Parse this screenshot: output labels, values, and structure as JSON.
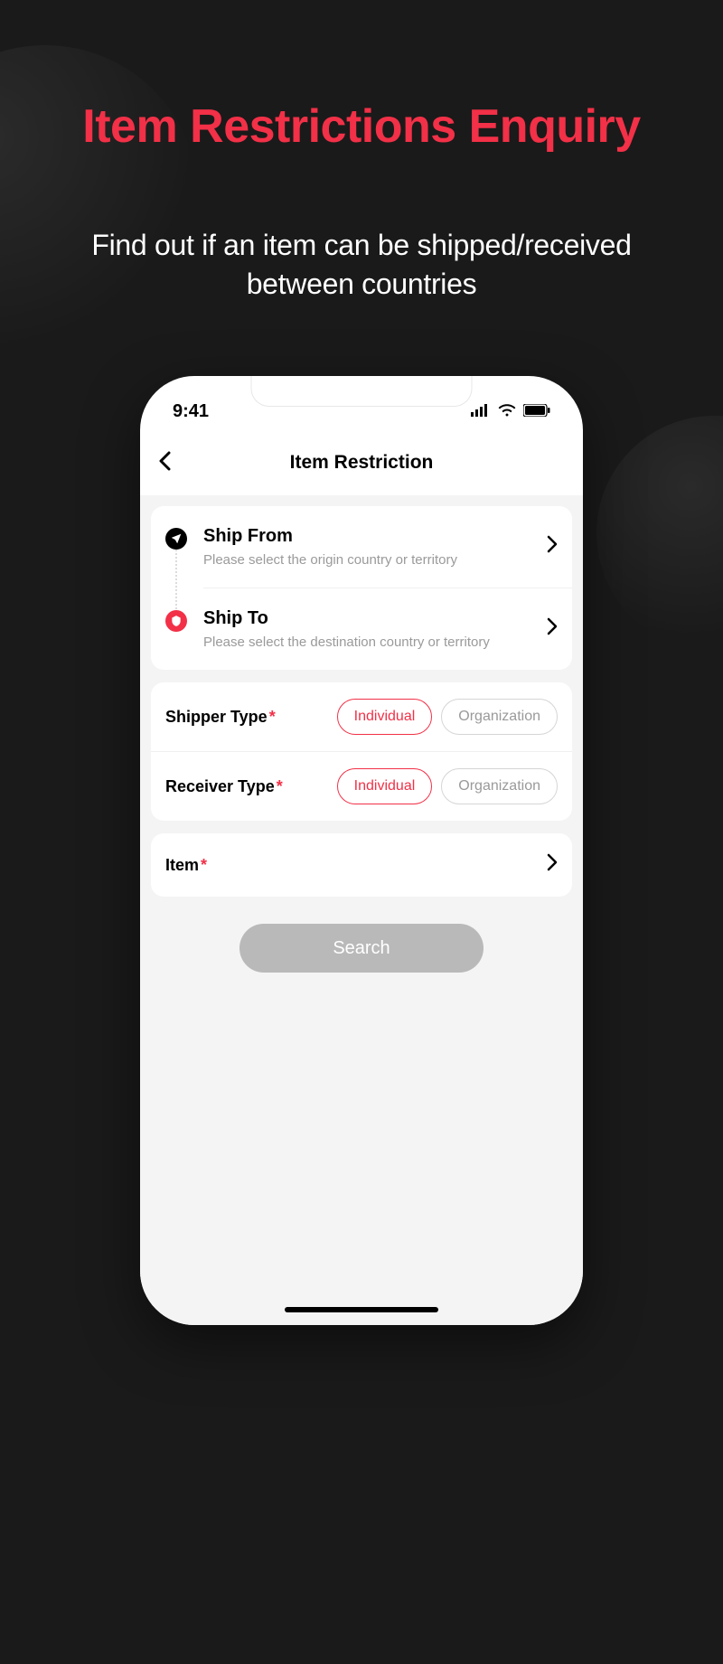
{
  "hero": {
    "title": "Item Restrictions Enquiry",
    "subtitle": "Find out if an item can be shipped/received between countries"
  },
  "status": {
    "time": "9:41"
  },
  "nav": {
    "title": "Item Restriction"
  },
  "ship_from": {
    "label": "Ship From",
    "hint": "Please select the origin country or territory"
  },
  "ship_to": {
    "label": "Ship To",
    "hint": "Please select the destination country or territory"
  },
  "shipper_type": {
    "label": "Shipper Type",
    "option_individual": "Individual",
    "option_organization": "Organization"
  },
  "receiver_type": {
    "label": "Receiver Type",
    "option_individual": "Individual",
    "option_organization": "Organization"
  },
  "item": {
    "label": "Item"
  },
  "actions": {
    "search": "Search"
  }
}
